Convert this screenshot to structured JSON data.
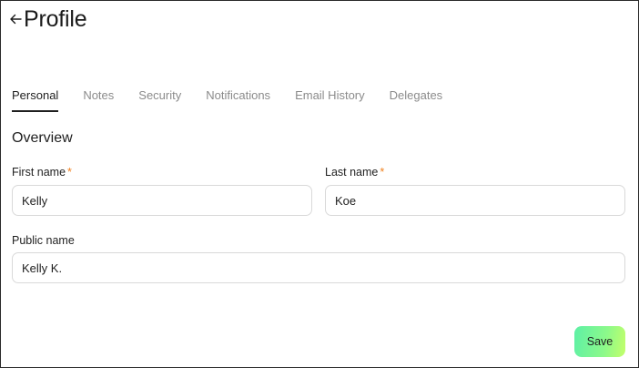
{
  "header": {
    "back_icon": "arrow-left-icon",
    "title": "Profile"
  },
  "tabs": [
    {
      "label": "Personal",
      "active": true
    },
    {
      "label": "Notes",
      "active": false
    },
    {
      "label": "Security",
      "active": false
    },
    {
      "label": "Notifications",
      "active": false
    },
    {
      "label": "Email History",
      "active": false
    },
    {
      "label": "Delegates",
      "active": false
    }
  ],
  "overview": {
    "title": "Overview",
    "first_name": {
      "label": "First name",
      "required_mark": "*",
      "value": "Kelly"
    },
    "last_name": {
      "label": "Last name",
      "required_mark": "*",
      "value": "Koe"
    },
    "public_name": {
      "label": "Public name",
      "value": "Kelly K."
    }
  },
  "actions": {
    "save_label": "Save"
  },
  "colors": {
    "required": "#f0801e",
    "save_gradient_start": "#5df0a6",
    "save_gradient_end": "#c4ff6a",
    "tab_inactive": "#8b8b8b"
  }
}
